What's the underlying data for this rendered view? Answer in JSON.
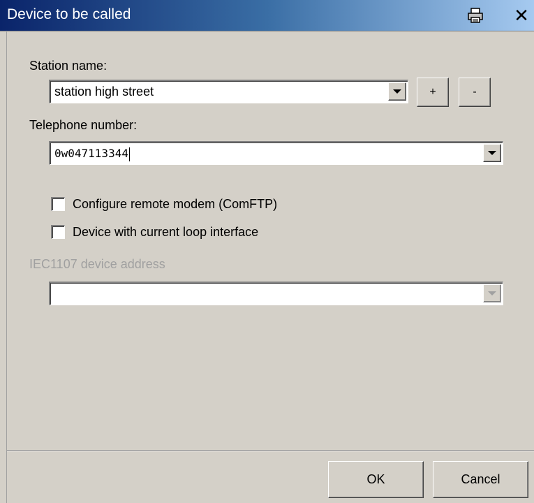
{
  "window": {
    "title": "Device to be called",
    "print_icon": "printer-icon",
    "close_label": "✕"
  },
  "form": {
    "station_label": "Station name:",
    "station_value": "station high street",
    "add_label": "+",
    "remove_label": "-",
    "telephone_label": "Telephone number:",
    "telephone_value": "0w047113344",
    "check_remote_modem": {
      "label": "Configure remote modem (ComFTP)",
      "checked": false
    },
    "check_current_loop": {
      "label": "Device with current loop interface",
      "checked": false
    },
    "iec_label": "IEC1107 device address",
    "iec_value": ""
  },
  "footer": {
    "ok_label": "OK",
    "cancel_label": "Cancel"
  },
  "colors": {
    "title_start": "#0a246a",
    "title_end": "#a6caf0",
    "face": "#d4d0c8",
    "disabled_text": "#a0a0a0"
  }
}
